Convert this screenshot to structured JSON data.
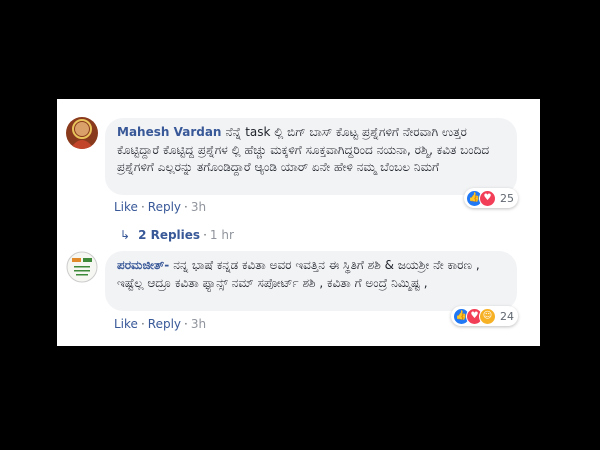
{
  "comments": [
    {
      "author": "Mahesh Vardan",
      "text": "ನೆನ್ನೆ task ಲ್ಲಿ ಬಿಗ್ ಬಾಸ್ ಕೊಟ್ಟ ಪ್ರಶ್ನೆಗಳಿಗೆ ನೇರವಾಗಿ ಉತ್ತರ ಕೊಟ್ಟಿದ್ದಾರೆ ಕೊಟ್ಟಿದ್ದ ಪ್ರಶ್ನೆಗಳ ಲ್ಲಿ ಹೆಚ್ಚು ಮಕ್ಕಳಿಗೆ ಸೂಕ್ತವಾಗಿದ್ದರಿಂದ ನಯನಾ, ರಶ್ಮಿ, ಕವಿತ ಬಂದಿದ ಪ್ರಶ್ನೆಗಳಿಗೆ ಎಲ್ಲರನ್ನು ತಗೊಂಡಿದ್ದಾರೆ ಆ್ಯಂಡಿ ಯಾರ್ ಏನೇ ಹೇಳಿ ನಮ್ಮ ಬೆಂಬಲ ನಿಮಗೆ",
      "like": "Like",
      "reply": "Reply",
      "time": "3h",
      "reaction_count": "25"
    },
    {
      "author": "ಪರಮಜೀತ್-",
      "text": "ನನ್ನ ಭಾಷೆ ಕನ್ನಡ ಕವಿತಾ ಅವರ ಇವತ್ತಿನ ಈ ಸ್ಥಿತಿಗೆ ಶಶಿ & ಜಯಶ್ರೀ ನೇ ಕಾರಣ , ಇಷ್ಟೆಲ್ಲ ಆದ್ರೂ ಕವಿತಾ ಫ್ಯಾನ್ಸ್ ನಮ್ ಸಪೋರ್ಟ್ ಶಶಿ , ಕವಿತಾ ಗೆ ಅಂದ್ರೆ ನಿಮ್ಮಿಷ್ಟ ,",
      "like": "Like",
      "reply": "Reply",
      "time": "3h",
      "reaction_count": "24"
    }
  ],
  "replies_link": {
    "label": "2 Replies",
    "time": "1 hr"
  },
  "colors": {
    "link": "#385898",
    "bubble": "#f2f3f5",
    "like_blue": "#2078f4",
    "love_red": "#f33e58",
    "haha_yellow": "#f7b125"
  },
  "icons": [
    "like-reaction-icon",
    "love-reaction-icon",
    "haha-reaction-icon",
    "reply-arrow-icon"
  ]
}
